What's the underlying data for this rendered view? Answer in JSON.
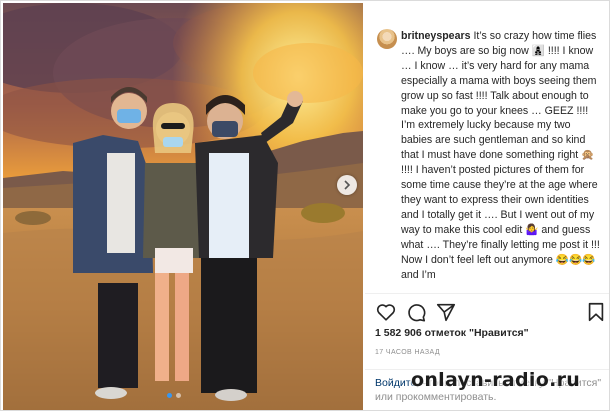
{
  "post": {
    "username": "britneyspears",
    "caption": "It’s so crazy how time flies …. My boys are so big now 👩‍👦‍👦 !!!! I know … I know … it’s very hard for any mama especially a mama with boys seeing them grow up so fast !!!! Talk about enough to make you go to your knees … GEEZ  !!!! I’m extremely lucky because my two babies are such gentleman and so kind that I must have done something right 🙊 !!!! I haven’t posted pictures of them for some time cause they’re at the age where they want to express their own identities and I totally get it …. But I went out of my way to make this cool edit 🤷‍♀️ and guess what …. They’re finally letting me post it !!! Now I don’t feel left out anymore 😂😂😂 and I’m",
    "likes": "1 582 906 отметок \"Нравится\"",
    "time_ago": "17 ЧАСОВ НАЗАД",
    "login_link": "Войдите",
    "login_rest": ", чтобы поставить отметку \"Нравится\" или прокомментировать."
  },
  "carousel": {
    "slide_count": 2,
    "active_slide": 1
  },
  "icons": {
    "like": "heart-icon",
    "comment": "comment-icon",
    "share": "share-icon",
    "save": "bookmark-icon",
    "next": "chevron-right-icon"
  },
  "colors": {
    "link": "#00376b",
    "muted": "#8e8e8e",
    "text": "#262626",
    "active_dot": "#3897f0"
  },
  "watermark": "onlayn-radio.ru"
}
